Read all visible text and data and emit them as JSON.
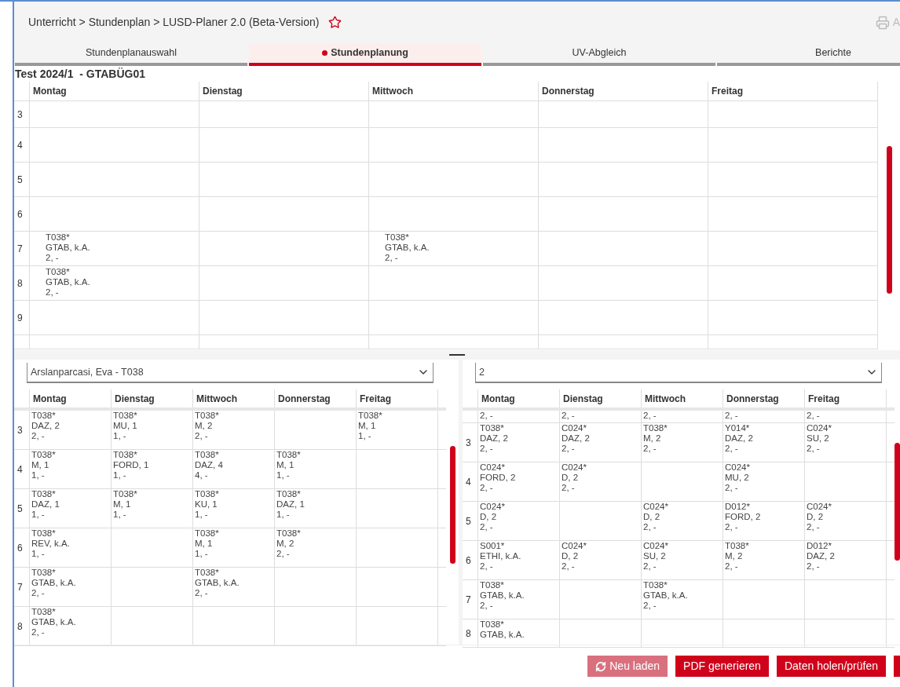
{
  "breadcrumb": "Unterricht > Stundenplan > LUSD-Planer 2.0 (Beta-Version)",
  "favorite": {
    "on": false
  },
  "toolbar_button": {
    "label": "A",
    "disabled": true
  },
  "tabs": [
    {
      "label": "Stundenplanauswahl",
      "selected": false
    },
    {
      "label": "Stundenplanung",
      "selected": true
    },
    {
      "label": "UV-Abgleich",
      "selected": false
    },
    {
      "label": "Berichte",
      "selected": false
    }
  ],
  "plan_title": "Test 2024/1  - GTABÜG01",
  "main_grid": {
    "columns": [
      "Montag",
      "Dienstag",
      "Mittwoch",
      "Donnerstag",
      "Freitag"
    ],
    "rows": [
      {
        "label": "3",
        "kind": "short",
        "cells": [
          null,
          null,
          null,
          null,
          null
        ]
      },
      {
        "label": "4",
        "kind": "full",
        "cells": [
          null,
          null,
          null,
          null,
          null
        ]
      },
      {
        "label": "5",
        "kind": "full",
        "cells": [
          null,
          null,
          null,
          null,
          null
        ]
      },
      {
        "label": "6",
        "kind": "full",
        "cells": [
          null,
          null,
          null,
          null,
          null
        ]
      },
      {
        "label": "7",
        "kind": "full",
        "cells": [
          [
            "T038*",
            "GTAB, k.A.",
            "2, -"
          ],
          null,
          [
            "T038*",
            "GTAB, k.A.",
            "2, -"
          ],
          null,
          null
        ]
      },
      {
        "label": "8",
        "kind": "full",
        "cells": [
          [
            "T038*",
            "GTAB, k.A.",
            "2, -"
          ],
          null,
          null,
          null,
          null
        ]
      },
      {
        "label": "9",
        "kind": "full",
        "cells": [
          null,
          null,
          null,
          null,
          null
        ]
      },
      {
        "kind": "cut",
        "cells": [
          null,
          null,
          null,
          null,
          null
        ]
      }
    ]
  },
  "left_panel": {
    "select": "Arslanparcasi, Eva - T038",
    "columns": [
      "Montag",
      "Dienstag",
      "Mittwoch",
      "Donnerstag",
      "Freitag"
    ],
    "rows": [
      {
        "label": "3",
        "kind": "full",
        "cells": [
          [
            "T038*",
            "DAZ, 2",
            "2, -"
          ],
          [
            "T038*",
            "MU, 1",
            "1, -"
          ],
          [
            "T038*",
            "M, 2",
            "2, -"
          ],
          null,
          [
            "T038*",
            "M, 1",
            "1, -"
          ]
        ]
      },
      {
        "label": "4",
        "kind": "full",
        "cells": [
          [
            "T038*",
            "M, 1",
            "1, -"
          ],
          [
            "T038*",
            "FORD, 1",
            "1, -"
          ],
          [
            "T038*",
            "DAZ, 4",
            "4, -"
          ],
          [
            "T038*",
            "M, 1",
            "1, -"
          ],
          null
        ]
      },
      {
        "label": "5",
        "kind": "full",
        "cells": [
          [
            "T038*",
            "DAZ, 1",
            "1, -"
          ],
          [
            "T038*",
            "M, 1",
            "1, -"
          ],
          [
            "T038*",
            "KU, 1",
            "1, -"
          ],
          [
            "T038*",
            "DAZ, 1",
            "1, -"
          ],
          null
        ]
      },
      {
        "label": "6",
        "kind": "full",
        "cells": [
          [
            "T038*",
            "REV, k.A.",
            "1, -"
          ],
          null,
          [
            "T038*",
            "M, 1",
            "1, -"
          ],
          [
            "T038*",
            "M, 2",
            "2, -"
          ],
          null
        ]
      },
      {
        "label": "7",
        "kind": "full",
        "cells": [
          [
            "T038*",
            "GTAB, k.A.",
            "2, -"
          ],
          null,
          [
            "T038*",
            "GTAB, k.A.",
            "2, -"
          ],
          null,
          null
        ]
      },
      {
        "label": "8",
        "kind": "full",
        "cells": [
          [
            "T038*",
            "GTAB, k.A.",
            "2, -"
          ],
          null,
          null,
          null,
          null
        ]
      }
    ]
  },
  "right_panel": {
    "select": "2",
    "columns": [
      "Montag",
      "Dienstag",
      "Mittwoch",
      "Donnerstag",
      "Freitag"
    ],
    "rows": [
      {
        "kind": "cut",
        "cells": [
          [
            "2, -"
          ],
          [
            "2, -"
          ],
          [
            "2, -"
          ],
          [
            "2, -"
          ],
          [
            "2, -"
          ]
        ]
      },
      {
        "label": "3",
        "kind": "full",
        "cells": [
          [
            "T038*",
            "DAZ, 2",
            "2, -"
          ],
          [
            "C024*",
            "DAZ, 2",
            "2, -"
          ],
          [
            "T038*",
            "M, 2",
            "2, -"
          ],
          [
            "Y014*",
            "DAZ, 2",
            "2, -"
          ],
          [
            "C024*",
            "SU, 2",
            "2, -"
          ]
        ]
      },
      {
        "label": "4",
        "kind": "full",
        "cells": [
          [
            "C024*",
            "FORD, 2",
            "2, -"
          ],
          [
            "C024*",
            "D, 2",
            "2, -"
          ],
          null,
          [
            "C024*",
            "MU, 2",
            "2, -"
          ],
          null
        ]
      },
      {
        "label": "5",
        "kind": "full",
        "cells": [
          [
            "C024*",
            "D, 2",
            "2, -"
          ],
          null,
          [
            "C024*",
            "D, 2",
            "2, -"
          ],
          [
            "D012*",
            "FORD, 2",
            "2, -"
          ],
          [
            "C024*",
            "D, 2",
            "2, -"
          ]
        ]
      },
      {
        "label": "6",
        "kind": "full",
        "cells": [
          [
            "S001*",
            "ETHI, k.A.",
            "2, -"
          ],
          [
            "C024*",
            "D, 2",
            "2, -"
          ],
          [
            "C024*",
            "SU, 2",
            "2, -"
          ],
          [
            "T038*",
            "M, 2",
            "2, -"
          ],
          [
            "D012*",
            "DAZ, 2",
            "2, -"
          ]
        ]
      },
      {
        "label": "7",
        "kind": "full",
        "cells": [
          [
            "T038*",
            "GTAB, k.A.",
            "2, -"
          ],
          null,
          [
            "T038*",
            "GTAB, k.A.",
            "2, -"
          ],
          null,
          null
        ]
      },
      {
        "label": "8",
        "kind": "short",
        "cells": [
          [
            "T038*",
            "GTAB, k.A."
          ],
          null,
          null,
          null,
          null
        ]
      }
    ]
  },
  "buttons": [
    {
      "label": "Neu laden",
      "kind": "reload",
      "disabled": true
    },
    {
      "label": "PDF generieren",
      "kind": "plain",
      "disabled": false
    },
    {
      "label": "Daten holen/prüfen",
      "kind": "plain",
      "disabled": false
    }
  ]
}
